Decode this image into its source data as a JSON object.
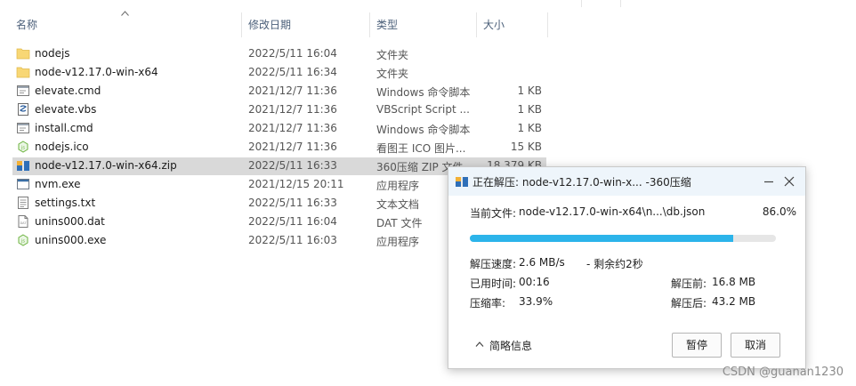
{
  "columns": {
    "name": "名称",
    "date": "修改日期",
    "type": "类型",
    "size": "大小"
  },
  "files": [
    {
      "name": "nodejs",
      "date": "2022/5/11 16:04",
      "type": "文件夹",
      "size": "",
      "icon": "folder"
    },
    {
      "name": "node-v12.17.0-win-x64",
      "date": "2022/5/11 16:34",
      "type": "文件夹",
      "size": "",
      "icon": "folder"
    },
    {
      "name": "elevate.cmd",
      "date": "2021/12/7 11:36",
      "type": "Windows 命令脚本",
      "size": "1 KB",
      "icon": "cmd"
    },
    {
      "name": "elevate.vbs",
      "date": "2021/12/7 11:36",
      "type": "VBScript Script ...",
      "size": "1 KB",
      "icon": "vbs"
    },
    {
      "name": "install.cmd",
      "date": "2021/12/7 11:36",
      "type": "Windows 命令脚本",
      "size": "1 KB",
      "icon": "cmd"
    },
    {
      "name": "nodejs.ico",
      "date": "2021/12/7 11:36",
      "type": "看图王 ICO 图片...",
      "size": "15 KB",
      "icon": "node"
    },
    {
      "name": "node-v12.17.0-win-x64.zip",
      "date": "2022/5/11 16:33",
      "type": "360压缩 ZIP 文件",
      "size": "18,379 KB",
      "icon": "zip",
      "selected": true
    },
    {
      "name": "nvm.exe",
      "date": "2021/12/15 20:11",
      "type": "应用程序",
      "size": "",
      "icon": "exe"
    },
    {
      "name": "settings.txt",
      "date": "2022/5/11 16:33",
      "type": "文本文档",
      "size": "",
      "icon": "txt"
    },
    {
      "name": "unins000.dat",
      "date": "2022/5/11 16:04",
      "type": "DAT 文件",
      "size": "",
      "icon": "dat"
    },
    {
      "name": "unins000.exe",
      "date": "2022/5/11 16:03",
      "type": "应用程序",
      "size": "",
      "icon": "node"
    }
  ],
  "dialog": {
    "title": "正在解压: node-v12.17.0-win-x... -360压缩",
    "current_file_label": "当前文件:",
    "current_file": "node-v12.17.0-win-x64\\n...\\db.json",
    "percent": "86.0%",
    "progress": 0.86,
    "speed_label": "解压速度:",
    "speed": "2.6 MB/s",
    "remaining": "- 剩余约2秒",
    "elapsed_label": "已用时间:",
    "elapsed": "00:16",
    "ratio_label": "压缩率:",
    "ratio": "33.9%",
    "before_label": "解压前:",
    "before": "16.8 MB",
    "after_label": "解压后:",
    "after": "43.2 MB",
    "brief_label": "简略信息",
    "pause_label": "暂停",
    "cancel_label": "取消"
  },
  "watermark": "CSDN @guanan1230",
  "colors": {
    "accent": "#2cb4ea",
    "selection": "#d9d9d9",
    "title_bg": "#eef5fb"
  }
}
